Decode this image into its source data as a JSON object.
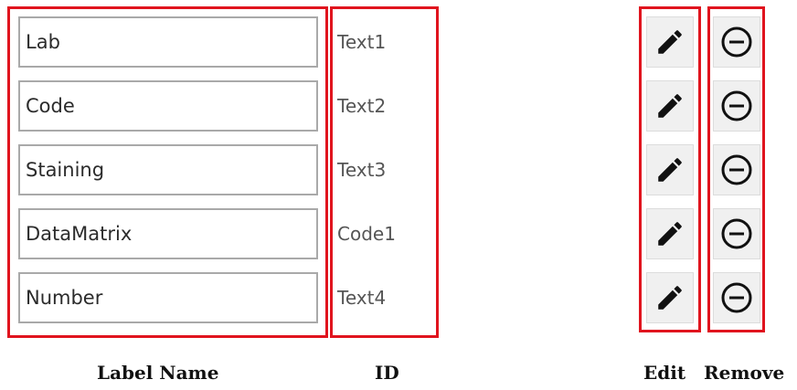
{
  "rows": [
    {
      "label": "Lab",
      "id": "Text1"
    },
    {
      "label": "Code",
      "id": "Text2"
    },
    {
      "label": "Staining",
      "id": "Text3"
    },
    {
      "label": "DataMatrix",
      "id": "Code1"
    },
    {
      "label": "Number",
      "id": "Text4"
    }
  ],
  "captions": {
    "label_name": "Label Name",
    "id": "ID",
    "edit": "Edit",
    "remove": "Remove"
  },
  "icons": {
    "edit": "pencil-icon",
    "remove": "minus-circle-icon"
  },
  "colors": {
    "highlight_border": "#e0141e",
    "field_border": "#a9a9a9",
    "button_bg": "#f0f0f0"
  }
}
